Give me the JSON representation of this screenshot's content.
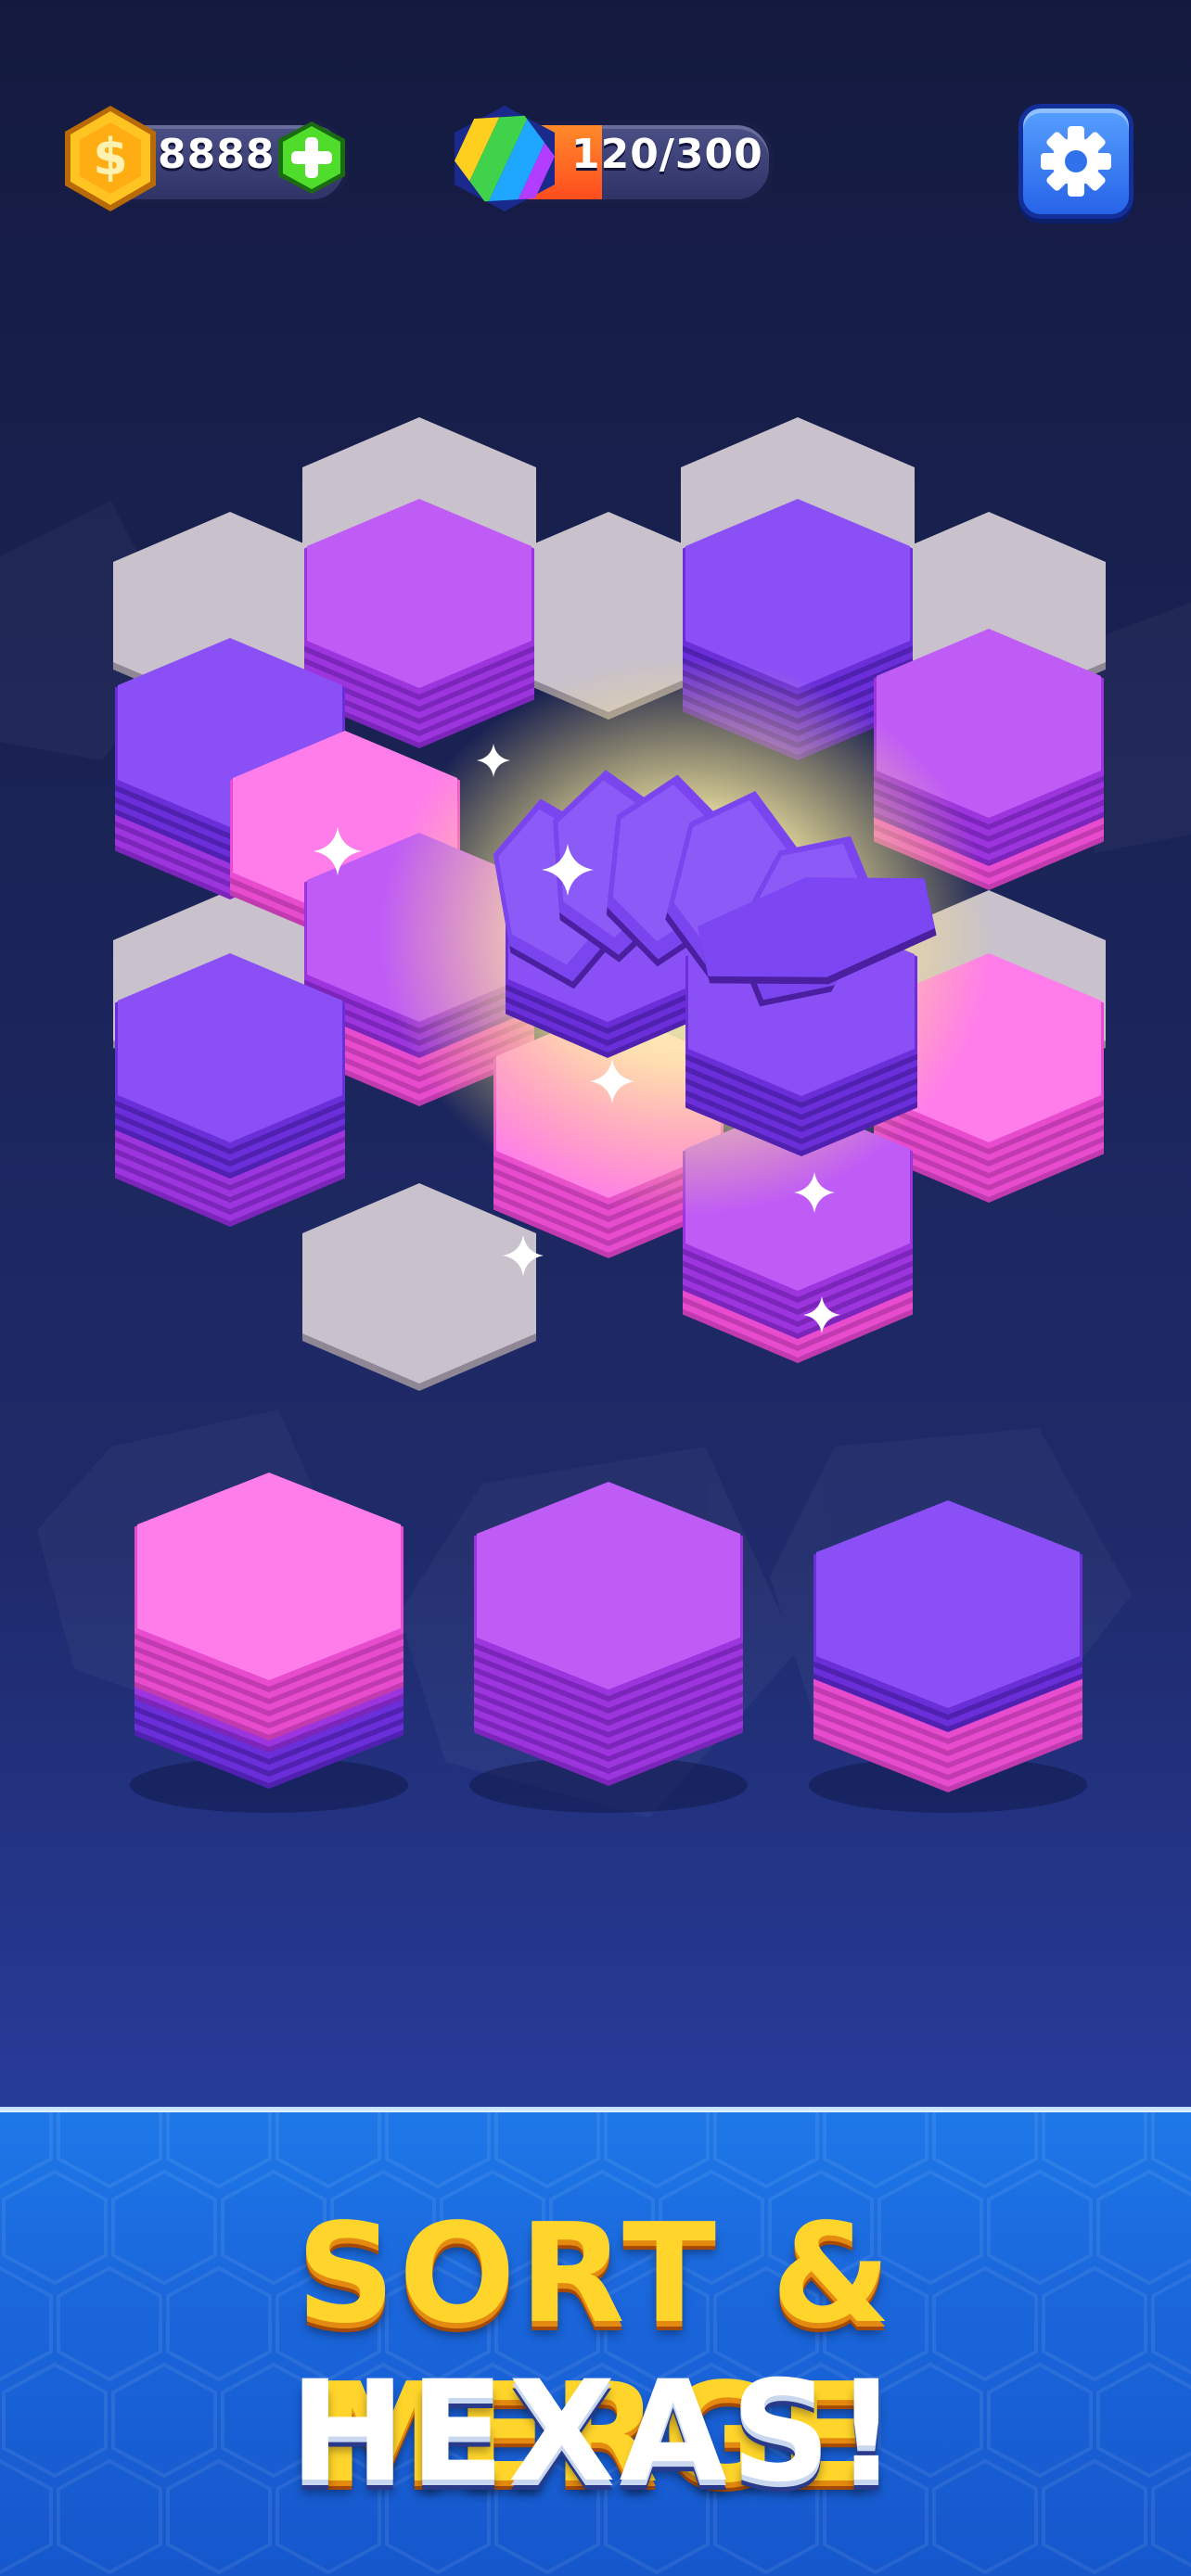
{
  "hud": {
    "coins": "8888",
    "coin_symbol": "$",
    "progress_text": "120/300",
    "progress_fraction": 0.4
  },
  "colors": {
    "pink": "#ff63e4",
    "violet": "#b447f2",
    "indigo": "#7b3cf0",
    "gray_cell": "#c9c1cc",
    "accent_yellow": "#ffd52b",
    "banner_blue": "#1a66db"
  },
  "icons": [
    "coin-icon",
    "plus-icon",
    "rainbow-hexa-icon",
    "gear-icon",
    "sparkle-icon"
  ],
  "banner": {
    "line1": "SORT & MERGE",
    "line2": "HEXAS!"
  }
}
